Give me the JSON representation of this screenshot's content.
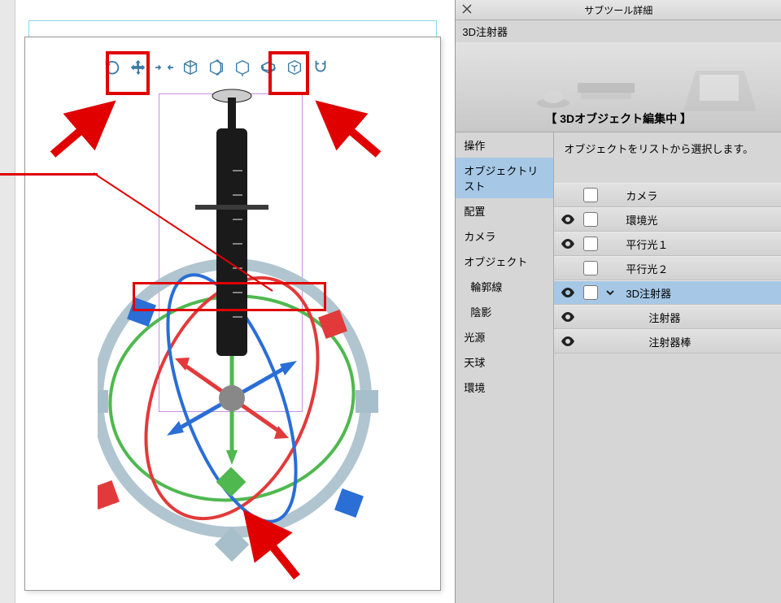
{
  "panel": {
    "title": "サブツール詳細",
    "tool_name": "3D注射器",
    "status": "【 3Dオブジェクト編集中 】",
    "info": "オブジェクトをリストから選択します。"
  },
  "categories": [
    {
      "label": "操作",
      "selected": false
    },
    {
      "label": "オブジェクトリスト",
      "selected": true
    },
    {
      "label": "配置",
      "selected": false
    },
    {
      "label": "カメラ",
      "selected": false
    },
    {
      "label": "オブジェクト",
      "selected": false
    },
    {
      "label": "輪郭線",
      "selected": false,
      "indent": true
    },
    {
      "label": "陰影",
      "selected": false,
      "indent": true
    },
    {
      "label": "光源",
      "selected": false
    },
    {
      "label": "天球",
      "selected": false
    },
    {
      "label": "環境",
      "selected": false
    }
  ],
  "objects": [
    {
      "label": "カメラ",
      "visible": false,
      "selected": false,
      "chev": false,
      "indent": 0
    },
    {
      "label": "環境光",
      "visible": true,
      "selected": false,
      "chev": false,
      "indent": 0
    },
    {
      "label": "平行光１",
      "visible": true,
      "selected": false,
      "chev": false,
      "indent": 0
    },
    {
      "label": "平行光２",
      "visible": false,
      "selected": false,
      "chev": false,
      "indent": 0
    },
    {
      "label": "3D注射器",
      "visible": true,
      "selected": true,
      "chev": true,
      "indent": 0
    },
    {
      "label": "注射器",
      "visible": true,
      "selected": false,
      "chev": false,
      "indent": 1
    },
    {
      "label": "注射器棒",
      "visible": true,
      "selected": false,
      "chev": false,
      "indent": 1
    }
  ],
  "toolbar3d": [
    {
      "name": "camera-rotate-icon"
    },
    {
      "name": "camera-pan-icon"
    },
    {
      "name": "camera-zoom-icon"
    },
    {
      "name": "object-move-icon"
    },
    {
      "name": "object-vertical-rotate-icon"
    },
    {
      "name": "object-snap-icon"
    },
    {
      "name": "object-rotate-icon"
    },
    {
      "name": "object-scale-icon"
    },
    {
      "name": "magnet-icon"
    }
  ]
}
